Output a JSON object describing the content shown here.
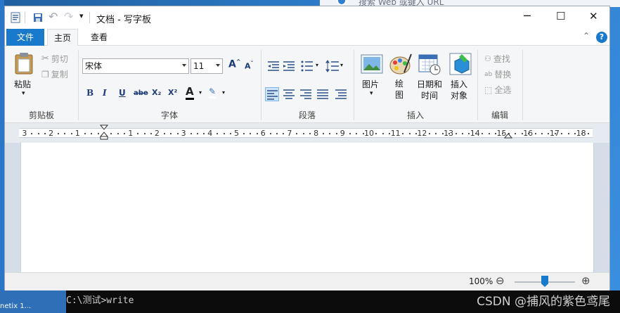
{
  "window": {
    "title": "文档 - 写字板",
    "controls": {
      "minimize": "─",
      "maximize": "☐",
      "close": "✕"
    }
  },
  "background": {
    "search_text": "搜索 Web 或键入 URL",
    "taskbar_label": "netix 1..."
  },
  "tabs": {
    "file": "文件",
    "home": "主页",
    "view": "查看"
  },
  "ribbon": {
    "clipboard": {
      "label": "剪贴板",
      "paste": "粘贴",
      "cut": "剪切",
      "copy": "复制"
    },
    "font": {
      "label": "字体",
      "family": "宋体",
      "size": "11",
      "buttons": [
        "B",
        "I",
        "U",
        "abe",
        "X₂",
        "X²",
        "A",
        "✎"
      ]
    },
    "paragraph": {
      "label": "段落"
    },
    "insert": {
      "label": "插入",
      "picture": "图片",
      "paint": "绘图",
      "datetime_1": "日期和",
      "datetime_2": "时间",
      "object_1": "插入",
      "object_2": "对象"
    },
    "editing": {
      "label": "编辑",
      "find": "查找",
      "replace": "替换",
      "select_all": "全选"
    }
  },
  "ruler": {
    "labels": [
      "3",
      "2",
      "1",
      "1",
      "2",
      "3",
      "4",
      "5",
      "6",
      "7",
      "8",
      "9",
      "10",
      "11",
      "12",
      "13",
      "14",
      "15",
      "16",
      "17",
      "18"
    ]
  },
  "statusbar": {
    "zoom": "100%",
    "zoom_out": "⊖",
    "zoom_in": "⊕",
    "zoom_level": 0.5
  },
  "console": {
    "text": "C:\\测试>write"
  },
  "watermark": "CSDN @捕风的紫色鸢尾",
  "colors": {
    "accent": "#1979ca",
    "ribbon_bg": "#f5f6f7"
  }
}
